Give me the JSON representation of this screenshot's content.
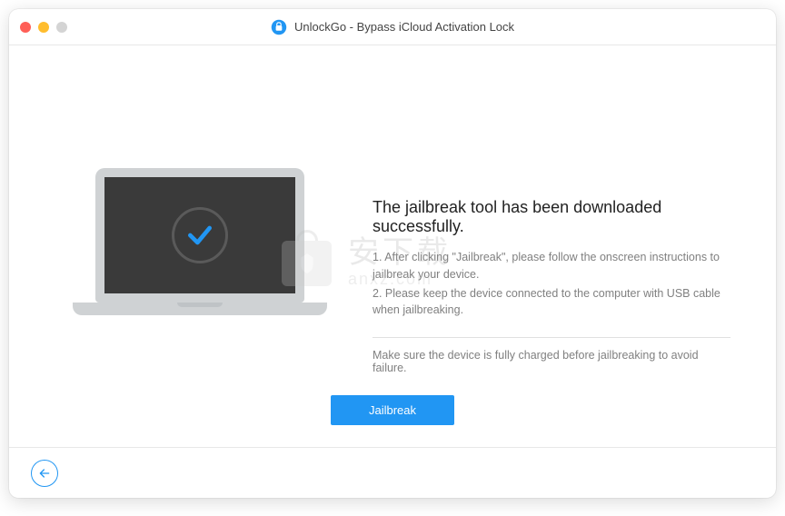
{
  "titlebar": {
    "title": "UnlockGo - Bypass iCloud Activation Lock"
  },
  "content": {
    "heading": "The jailbreak tool has been downloaded successfully.",
    "instruction1": "1. After clicking \"Jailbreak\", please follow the onscreen instructions to jailbreak your device.",
    "instruction2": "2. Please keep the device connected to the computer with USB cable when jailbreaking.",
    "warning": "Make sure the device is fully charged before jailbreaking to avoid failure."
  },
  "buttons": {
    "jailbreak": "Jailbreak"
  },
  "watermark": {
    "cn": "安下载",
    "url": "anxz.com"
  }
}
